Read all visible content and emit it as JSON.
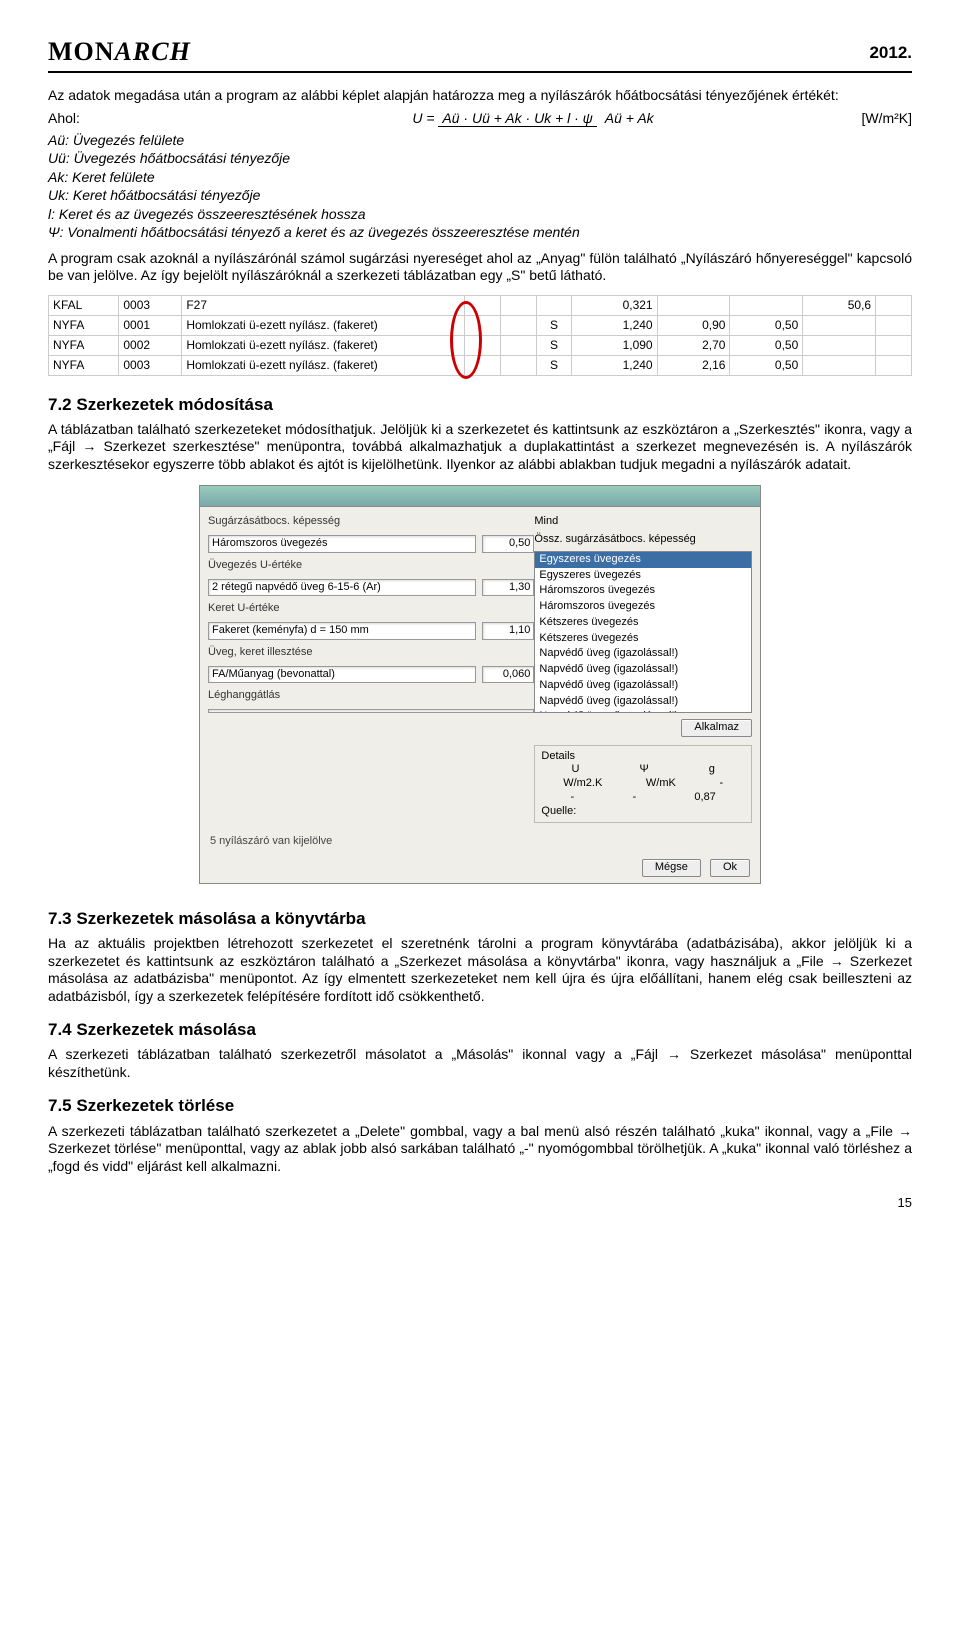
{
  "header": {
    "logo_part1": "MON",
    "logo_part2": "ARCH",
    "year": "2012."
  },
  "intro": "Az adatok megadása után a program az alábbi képlet alapján határozza meg a nyílászárók hőátbocsátási tényezőjének értékét:",
  "formula": {
    "where": "Ahol:",
    "unit": "[W/m²K]",
    "num": "Aü · Uü + Ak · Uk + l · ψ",
    "den": "Aü + Ak"
  },
  "defs": {
    "Au": "Aü: Üvegezés felülete",
    "Uu": "Uü: Üvegezés hőátbocsátási tényezője",
    "Ak": "Ak: Keret felülete",
    "Uk": "Uk: Keret hőátbocsátási tényezője",
    "l": "l: Keret és az üvegezés összeeresztésének hossza",
    "psi": "Ψ: Vonalmenti hőátbocsátási tényező a keret és az üvegezés összeeresztése mentén"
  },
  "para2": "A program csak azoknál a nyílászárónál számol sugárzási nyereséget ahol az „Anyag\" fülön található „Nyílászáró hőnyereséggel\" kapcsoló be van jelölve. Az így bejelölt nyílászáróknál a szerkezeti táblázatban egy „S\" betű látható.",
  "table": {
    "rows": [
      [
        "KFAL",
        "0003",
        "F27",
        "",
        "",
        "",
        "0,321",
        "",
        "",
        "50,6",
        ""
      ],
      [
        "NYFA",
        "0001",
        "Homlokzati ü-ezett nyílász. (fakeret)",
        "",
        "",
        "S",
        "1,240",
        "0,90",
        "0,50",
        "",
        ""
      ],
      [
        "NYFA",
        "0002",
        "Homlokzati ü-ezett nyílász. (fakeret)",
        "",
        "",
        "S",
        "1,090",
        "2,70",
        "0,50",
        "",
        ""
      ],
      [
        "NYFA",
        "0003",
        "Homlokzati ü-ezett nyílász. (fakeret)",
        "",
        "",
        "S",
        "1,240",
        "2,16",
        "0,50",
        "",
        ""
      ]
    ]
  },
  "sec72": {
    "title": "7.2 Szerkezetek módosítása",
    "body": "A táblázatban található szerkezeteket módosíthatjuk. Jelöljük ki a szerkezetet és kattintsunk az eszköztáron a „Szerkesztés\" ikonra, vagy a „Fájl → Szerkezet szerkesztése\" menüpontra, továbbá alkalmazhatjuk a duplakattintást a szerkezet megnevezésén is. A nyílászárók szerkesztésekor egyszerre több ablakot és ajtót is kijelölhetünk. Ilyenkor az alábbi ablakban tudjuk megadni a nyílászárók adatait."
  },
  "dialog": {
    "r1_label": "Sugárzásátbocs. képesség",
    "r1_v1": "Háromszoros üvegezés",
    "r1_v2": "0,50",
    "r2_label": "Üvegezés U-értéke",
    "r2_v1": "2 rétegű napvédő üveg 6-15-6 (Ar)",
    "r2_v2": "1,30",
    "r3_label": "Keret U-értéke",
    "r3_v1": "Fakeret (keményfa) d = 150 mm",
    "r3_v2": "1,10",
    "r4_label": "Üveg, keret illesztése",
    "r4_v1": "FA/Műanyag (bevonattal)",
    "r4_v2": "0,060",
    "r5_label": "Léghanggátlás",
    "r5_v1": "",
    "right_top": "Mind",
    "right_list_title": "Össz. sugárzásátbocs. képesség",
    "list": [
      "Egyszeres üvegezés",
      "Egyszeres üvegezés",
      "Háromszoros üvegezés",
      "Háromszoros üvegezés",
      "Kétszeres üvegezés",
      "Kétszeres üvegezés",
      "Napvédő üveg (igazolással!)",
      "Napvédő üveg (igazolással!)",
      "Napvédő üveg (igazolással!)",
      "Napvédő üveg (igazolással!)",
      "Napvédő üveg (igazolással!)"
    ],
    "apply": "Alkalmaz",
    "details_title": "Details",
    "d_c1": "U",
    "d_c2": "Ψ",
    "d_c3": "g",
    "d_u": "W/m2.K",
    "d_u2": "W/mK",
    "d_u3": "-",
    "d_v1": "-",
    "d_v2": "-",
    "d_v3": "0,87",
    "quelle": "Quelle:",
    "status": "5  nyílászáró van kijelölve",
    "cancel": "Mégse",
    "ok": "Ok"
  },
  "sec73": {
    "title": "7.3 Szerkezetek másolása a könyvtárba",
    "body": "Ha az aktuális projektben létrehozott szerkezetet el szeretnénk tárolni a program könyvtárába (adatbázisába), akkor jelöljük ki a szerkezetet és kattintsunk az eszköztáron található a „Szerkezet másolása a könyvtárba\" ikonra, vagy használjuk a „File → Szerkezet másolása az adatbázisba\" menüpontot. Az így elmentett szerkezeteket nem kell újra és újra előállítani, hanem elég csak beilleszteni az adatbázisból, így a szerkezetek felépítésére fordított idő csökkenthető."
  },
  "sec74": {
    "title": "7.4 Szerkezetek másolása",
    "body": "A szerkezeti táblázatban található szerkezetről másolatot a „Másolás\" ikonnal vagy a „Fájl → Szerkezet másolása\" menüponttal készíthetünk."
  },
  "sec75": {
    "title": "7.5 Szerkezetek törlése",
    "body": "A szerkezeti táblázatban található szerkezetet a „Delete\" gombbal, vagy a bal menü alsó részén található „kuka\" ikonnal, vagy a „File → Szerkezet törlése\" menüponttal, vagy az ablak jobb alsó sarkában található „-\" nyomógombbal törölhetjük. A „kuka\" ikonnal való törléshez a „fogd és vidd\" eljárást kell alkalmazni."
  },
  "page": "15"
}
